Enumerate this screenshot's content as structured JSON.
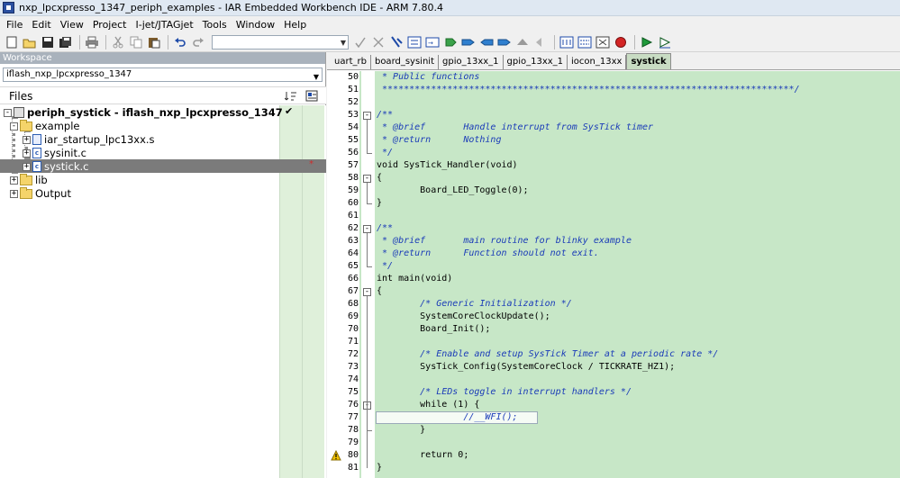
{
  "window": {
    "title": "nxp_lpcxpresso_1347_periph_examples - IAR Embedded Workbench IDE - ARM 7.80.4"
  },
  "menu": {
    "items": [
      "File",
      "Edit",
      "View",
      "Project",
      "I-jet/JTAGjet",
      "Tools",
      "Window",
      "Help"
    ]
  },
  "toolbar": {
    "left_icons": [
      "new-file-icon",
      "open-icon",
      "save-icon",
      "save-all-icon",
      "print-icon",
      "cut-icon",
      "copy-icon",
      "paste-icon",
      "undo-icon",
      "redo-icon"
    ],
    "search_value": "",
    "right_icons": [
      "check-icon",
      "find-icon",
      "find-next-icon",
      "replace-icon",
      "go-to-icon",
      "bookmark-icon",
      "bookmark-next-icon",
      "nav-back-icon",
      "nav-forward-icon",
      "nav-up-icon",
      "compile-icon",
      "make-icon",
      "stop-icon",
      "breakpoint-icon",
      "debug-icon",
      "debug-no-download-icon"
    ]
  },
  "workspace": {
    "header": "Workspace",
    "config": "iflash_nxp_lpcxpresso_1347",
    "files_label": "Files",
    "tree": [
      {
        "label": "periph_systick - iflash_nxp_lpcxpresso_1347",
        "type": "project",
        "depth": 0,
        "expander": "-",
        "bold": true,
        "check": "✔",
        "star": ""
      },
      {
        "label": "example",
        "type": "folder",
        "depth": 1,
        "expander": "-",
        "bold": false,
        "check": "",
        "star": ""
      },
      {
        "label": "iar_startup_lpc13xx.s",
        "type": "asm",
        "depth": 2,
        "expander": "+",
        "bold": false,
        "check": "",
        "star": ""
      },
      {
        "label": "sysinit.c",
        "type": "c",
        "depth": 2,
        "expander": "+",
        "bold": false,
        "check": "",
        "star": ""
      },
      {
        "label": "systick.c",
        "type": "c",
        "depth": 2,
        "expander": "+",
        "bold": false,
        "check": "",
        "star": "*",
        "selected": true
      },
      {
        "label": "lib",
        "type": "folder",
        "depth": 1,
        "expander": "+",
        "bold": false,
        "check": "",
        "star": ""
      },
      {
        "label": "Output",
        "type": "folder",
        "depth": 1,
        "expander": "+",
        "bold": false,
        "check": "",
        "star": ""
      }
    ]
  },
  "editor": {
    "tabs": [
      "uart_rb",
      "board_sysinit",
      "gpio_13xx_1",
      "gpio_13xx_1",
      "iocon_13xx",
      "systick"
    ],
    "active_tab": "systick",
    "lines": [
      {
        "num": "50",
        "text": " * Public functions",
        "kind": "comment"
      },
      {
        "num": "51",
        "text": " ****************************************************************************/",
        "kind": "comment"
      },
      {
        "num": "52",
        "text": "",
        "kind": "code"
      },
      {
        "num": "53",
        "text": "/**",
        "kind": "comment",
        "fold": "-"
      },
      {
        "num": "54",
        "text": " * @brief       Handle interrupt from SysTick timer",
        "kind": "comment"
      },
      {
        "num": "55",
        "text": " * @return      Nothing",
        "kind": "comment"
      },
      {
        "num": "56",
        "text": " */",
        "kind": "comment",
        "fold_end": true
      },
      {
        "num": "57",
        "text": "void SysTick_Handler(void)",
        "kind": "code"
      },
      {
        "num": "58",
        "text": "{",
        "kind": "code",
        "fold": "-"
      },
      {
        "num": "59",
        "text": "        Board_LED_Toggle(0);",
        "kind": "code"
      },
      {
        "num": "60",
        "text": "}",
        "kind": "code",
        "fold_end": true
      },
      {
        "num": "61",
        "text": "",
        "kind": "code"
      },
      {
        "num": "62",
        "text": "/**",
        "kind": "comment",
        "fold": "-"
      },
      {
        "num": "63",
        "text": " * @brief       main routine for blinky example",
        "kind": "comment"
      },
      {
        "num": "64",
        "text": " * @return      Function should not exit.",
        "kind": "comment"
      },
      {
        "num": "65",
        "text": " */",
        "kind": "comment",
        "fold_end": true
      },
      {
        "num": "66",
        "text": "int main(void)",
        "kind": "code"
      },
      {
        "num": "67",
        "text": "{",
        "kind": "code",
        "fold": "-"
      },
      {
        "num": "68",
        "text": "        /* Generic Initialization */",
        "kind": "comment"
      },
      {
        "num": "69",
        "text": "        SystemCoreClockUpdate();",
        "kind": "code"
      },
      {
        "num": "70",
        "text": "        Board_Init();",
        "kind": "code"
      },
      {
        "num": "71",
        "text": "",
        "kind": "code"
      },
      {
        "num": "72",
        "text": "        /* Enable and setup SysTick Timer at a periodic rate */",
        "kind": "comment"
      },
      {
        "num": "73",
        "text": "        SysTick_Config(SystemCoreClock / TICKRATE_HZ1);",
        "kind": "code"
      },
      {
        "num": "74",
        "text": "",
        "kind": "code"
      },
      {
        "num": "75",
        "text": "        /* LEDs toggle in interrupt handlers */",
        "kind": "comment"
      },
      {
        "num": "76",
        "text": "        while (1) {",
        "kind": "code",
        "fold": "-"
      },
      {
        "num": "77",
        "text": "                //__WFI();",
        "kind": "comment",
        "current": true
      },
      {
        "num": "78",
        "text": "        }",
        "kind": "code",
        "fold_end": true
      },
      {
        "num": "79",
        "text": "",
        "kind": "code"
      },
      {
        "num": "80",
        "text": "        return 0;",
        "kind": "code",
        "warning": true
      },
      {
        "num": "81",
        "text": "}",
        "kind": "code"
      }
    ]
  },
  "colors": {
    "editor_bg": "#c7e7c7",
    "comment": "#1a3bb8",
    "selection": "#7b7b7b"
  }
}
